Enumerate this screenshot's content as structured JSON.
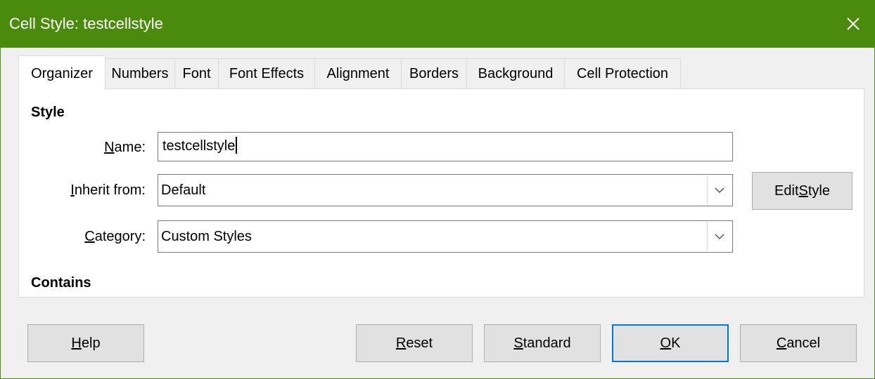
{
  "window": {
    "title": "Cell Style: testcellstyle"
  },
  "tabs": [
    {
      "label": "Organizer",
      "active": true
    },
    {
      "label": "Numbers"
    },
    {
      "label": "Font"
    },
    {
      "label": "Font Effects"
    },
    {
      "label": "Alignment"
    },
    {
      "label": "Borders"
    },
    {
      "label": "Background"
    },
    {
      "label": "Cell Protection"
    }
  ],
  "style_section": {
    "heading": "Style",
    "name_label_pre": "",
    "name_label_u": "N",
    "name_label_post": "ame:",
    "name_value": "testcellstyle",
    "inherit_label_pre": "",
    "inherit_label_u": "I",
    "inherit_label_post": "nherit from:",
    "inherit_value": "Default",
    "category_label_pre": "",
    "category_label_u": "C",
    "category_label_post": "ategory:",
    "category_value": "Custom Styles",
    "edit_style_pre": "Edit ",
    "edit_style_u": "S",
    "edit_style_post": "tyle"
  },
  "contains_section": {
    "heading": "Contains"
  },
  "buttons": {
    "help_u": "H",
    "help_post": "elp",
    "reset_u": "R",
    "reset_post": "eset",
    "standard_u": "S",
    "standard_post": "tandard",
    "ok_u": "O",
    "ok_post": "K",
    "cancel_u": "C",
    "cancel_post": "ancel"
  },
  "colors": {
    "titlebar": "#4a8a0c",
    "default_button_border": "#0078d7"
  },
  "icons": {
    "close": "close-icon",
    "dropdown": "chevron-down-icon"
  }
}
